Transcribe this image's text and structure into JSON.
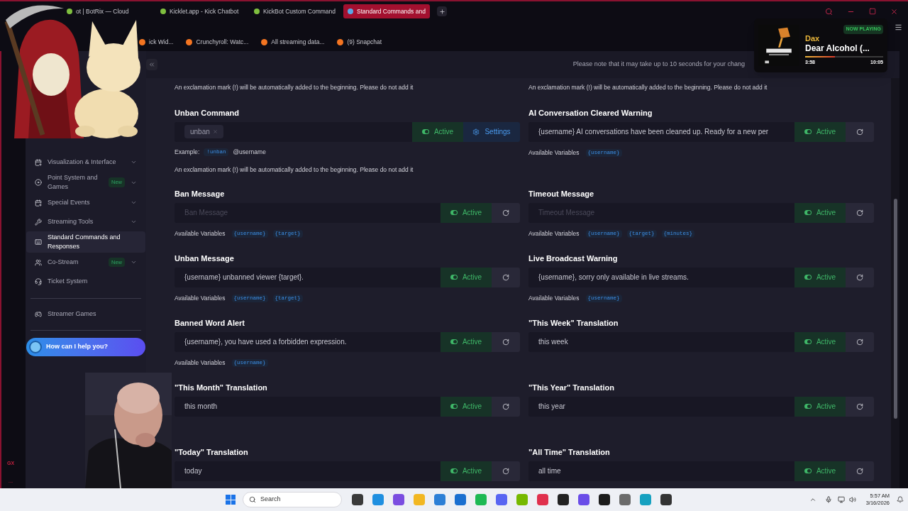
{
  "browser": {
    "tabs": [
      {
        "title": "ot | BotRix — Cloud",
        "selected": false
      },
      {
        "title": "Kicklet.app - Kick Chatbot",
        "selected": false
      },
      {
        "title": "KickBot Custom Command",
        "selected": false
      },
      {
        "title": "Standard Commands and",
        "selected": true
      }
    ],
    "bookmarks": [
      "ick Wid...",
      "Crunchyroll: Watc...",
      "All streaming data...",
      "(9) Snapchat"
    ],
    "rail_label": "GX",
    "rail_more": "..."
  },
  "sidebar": {
    "items": [
      {
        "label": "Visualization & Interface",
        "expandable": true,
        "selected": false
      },
      {
        "label": "Point System and Games",
        "badge": "New",
        "expandable": true,
        "selected": false
      },
      {
        "label": "Special Events",
        "expandable": true,
        "selected": false
      },
      {
        "label": "Streaming Tools",
        "expandable": true,
        "selected": false
      },
      {
        "label": "Standard Commands and Responses",
        "expandable": false,
        "selected": true
      },
      {
        "label": "Co-Stream",
        "badge": "New",
        "expandable": true,
        "selected": false
      },
      {
        "label": "Ticket System",
        "expandable": false,
        "selected": false
      }
    ],
    "footer_items": [
      {
        "label": "Streamer Games",
        "selected": false
      }
    ],
    "help": "How can I help you?"
  },
  "notice": "Please note that it may take up to 10 seconds for your chang",
  "rows": [
    {
      "left": {
        "note_before": "An exclamation mark (!) will be automatically added to the beginning. Please do not add it",
        "title": "Unban Command",
        "kind": "tags",
        "tags": [
          "unban"
        ],
        "active": true,
        "toggle_label": "Active",
        "action_label": "Settings",
        "example": {
          "label": "Example:",
          "command": "!unban",
          "suffix": "@username"
        },
        "note_after": "An exclamation mark (!) will be automatically added to the beginning. Please do not add it"
      },
      "right": {
        "note_before": "An exclamation mark (!) will be automatically added to the beginning. Please do not add it",
        "title": "AI Conversation Cleared Warning",
        "kind": "text",
        "value": "{username} AI conversations have been cleaned up. Ready for a new per",
        "active": true,
        "toggle_label": "Active",
        "variables_label": "Available Variables",
        "variables": [
          "{username}"
        ]
      }
    },
    {
      "left": {
        "title": "Ban Message",
        "kind": "text",
        "placeholder": "Ban Message",
        "active": true,
        "toggle_label": "Active",
        "variables_label": "Available Variables",
        "variables": [
          "{username}",
          "{target}"
        ]
      },
      "right": {
        "title": "Timeout Message",
        "kind": "text",
        "placeholder": "Timeout Message",
        "active": true,
        "toggle_label": "Active",
        "variables_label": "Available Variables",
        "variables": [
          "{username}",
          "{target}",
          "{minutes}"
        ]
      }
    },
    {
      "left": {
        "title": "Unban Message",
        "kind": "text",
        "value": "{username} unbanned viewer {target}.",
        "active": true,
        "toggle_label": "Active",
        "variables_label": "Available Variables",
        "variables": [
          "{username}",
          "{target}"
        ]
      },
      "right": {
        "title": "Live Broadcast Warning",
        "kind": "text",
        "value": "{username}, sorry only available in live streams.",
        "active": true,
        "toggle_label": "Active",
        "variables_label": "Available Variables",
        "variables": [
          "{username}"
        ]
      }
    },
    {
      "left": {
        "title": "Banned Word Alert",
        "kind": "text",
        "value": "{username}, you have used a forbidden expression.",
        "active": true,
        "toggle_label": "Active",
        "variables_label": "Available Variables",
        "variables": [
          "{username}"
        ]
      },
      "right": {
        "title": "\"This Week\" Translation",
        "kind": "text",
        "value": "this week",
        "active": true,
        "toggle_label": "Active"
      }
    },
    {
      "left": {
        "title": "\"This Month\" Translation",
        "kind": "text",
        "value": "this month",
        "active": true,
        "toggle_label": "Active"
      },
      "right": {
        "title": "\"This Year\" Translation",
        "kind": "text",
        "value": "this year",
        "active": true,
        "toggle_label": "Active"
      }
    },
    {
      "left": {
        "title": "\"Today\" Translation",
        "kind": "text",
        "value": "today",
        "active": true,
        "toggle_label": "Active"
      },
      "right": {
        "title": "\"All Time\" Translation",
        "kind": "text",
        "value": "all time",
        "active": true,
        "toggle_label": "Active"
      }
    }
  ],
  "now_playing": {
    "badge": "NOW PLAYING",
    "artist": "Dax",
    "title": "Dear Alcohol (...",
    "elapsed": "3:58",
    "duration": "10:05",
    "level": 0.38
  },
  "taskbar": {
    "search": "Search",
    "time": "5:57 AM",
    "date": "3/16/2026"
  }
}
